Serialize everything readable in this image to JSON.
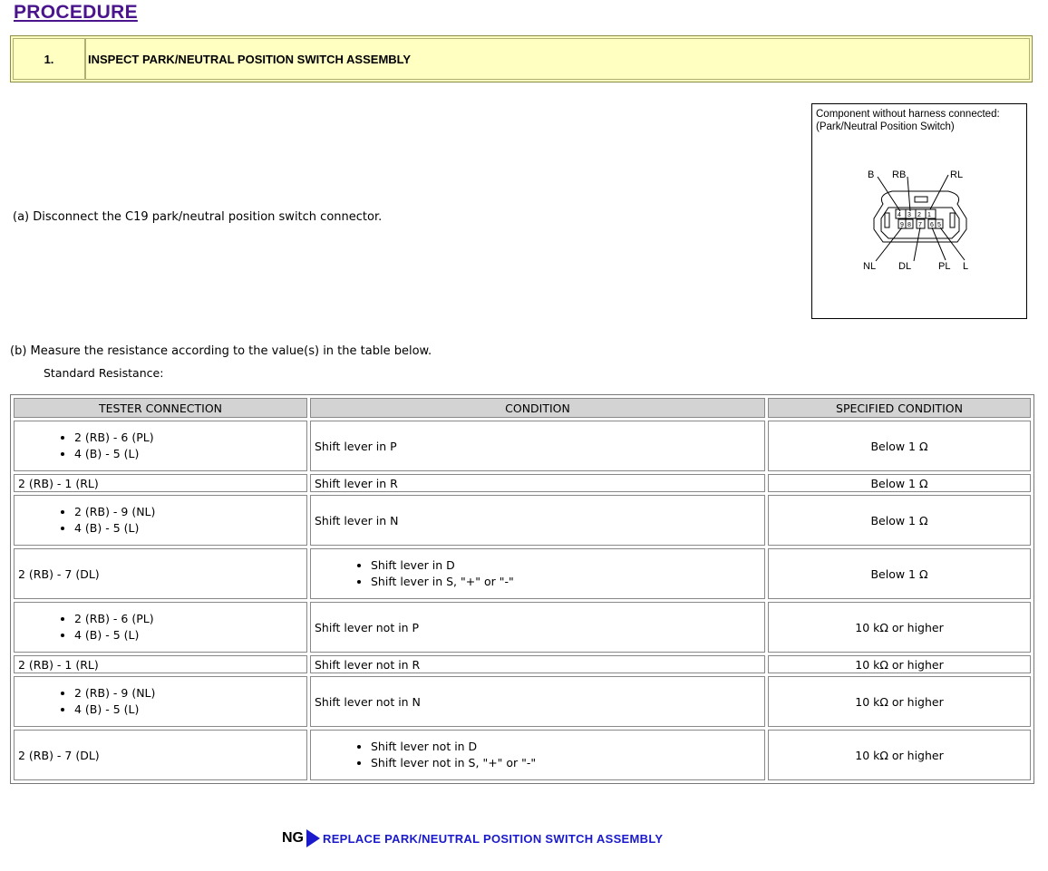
{
  "heading": "PROCEDURE",
  "step": {
    "number": "1.",
    "title": "INSPECT PARK/NEUTRAL POSITION SWITCH ASSEMBLY"
  },
  "instruction_a": "(a) Disconnect the C19 park/neutral position switch connector.",
  "figure": {
    "caption_line1": "Component without harness connected:",
    "caption_line2": "(Park/Neutral Position Switch)",
    "top_labels": [
      "B",
      "RB",
      "RL"
    ],
    "bottom_labels": [
      "NL",
      "DL",
      "PL",
      "L"
    ],
    "top_pins": [
      "4",
      "3",
      "2",
      "1"
    ],
    "bottom_pins": [
      "9",
      "8",
      "7",
      "6",
      "5"
    ]
  },
  "instruction_b": "(b) Measure the resistance according to the value(s) in the table below.",
  "standard_label": "Standard Resistance:",
  "table": {
    "headers": [
      "TESTER CONNECTION",
      "CONDITION",
      "SPECIFIED CONDITION"
    ],
    "rows": [
      {
        "tester": [
          "2 (RB) - 6 (PL)",
          "4 (B) - 5 (L)"
        ],
        "condition": [
          "Shift lever in P"
        ],
        "spec": "Below 1 Ω"
      },
      {
        "tester": [
          "2 (RB) - 1 (RL)"
        ],
        "condition": [
          "Shift lever in R"
        ],
        "spec": "Below 1 Ω"
      },
      {
        "tester": [
          "2 (RB) - 9 (NL)",
          "4 (B) - 5 (L)"
        ],
        "condition": [
          "Shift lever in N"
        ],
        "spec": "Below 1 Ω"
      },
      {
        "tester": [
          "2 (RB) - 7 (DL)"
        ],
        "condition": [
          "Shift lever in D",
          "Shift lever in S, \"+\" or \"-\""
        ],
        "spec": "Below 1 Ω"
      },
      {
        "tester": [
          "2 (RB) - 6 (PL)",
          "4 (B) - 5 (L)"
        ],
        "condition": [
          "Shift lever not in P"
        ],
        "spec": "10 kΩ or higher"
      },
      {
        "tester": [
          "2 (RB) - 1 (RL)"
        ],
        "condition": [
          "Shift lever not in R"
        ],
        "spec": "10 kΩ or higher"
      },
      {
        "tester": [
          "2 (RB) - 9 (NL)",
          "4 (B) - 5 (L)"
        ],
        "condition": [
          "Shift lever not in N"
        ],
        "spec": "10 kΩ or higher"
      },
      {
        "tester": [
          "2 (RB) - 7 (DL)"
        ],
        "condition": [
          "Shift lever not in D",
          "Shift lever not in S, \"+\" or \"-\""
        ],
        "spec": "10 kΩ or higher"
      }
    ]
  },
  "ng": {
    "label": "NG",
    "link": "REPLACE PARK/NEUTRAL POSITION SWITCH ASSEMBLY"
  },
  "colors": {
    "heading": "#4a148c",
    "step_bg": "#ffffc2",
    "link": "#1a1acc",
    "header_bg": "#d3d3d3"
  }
}
